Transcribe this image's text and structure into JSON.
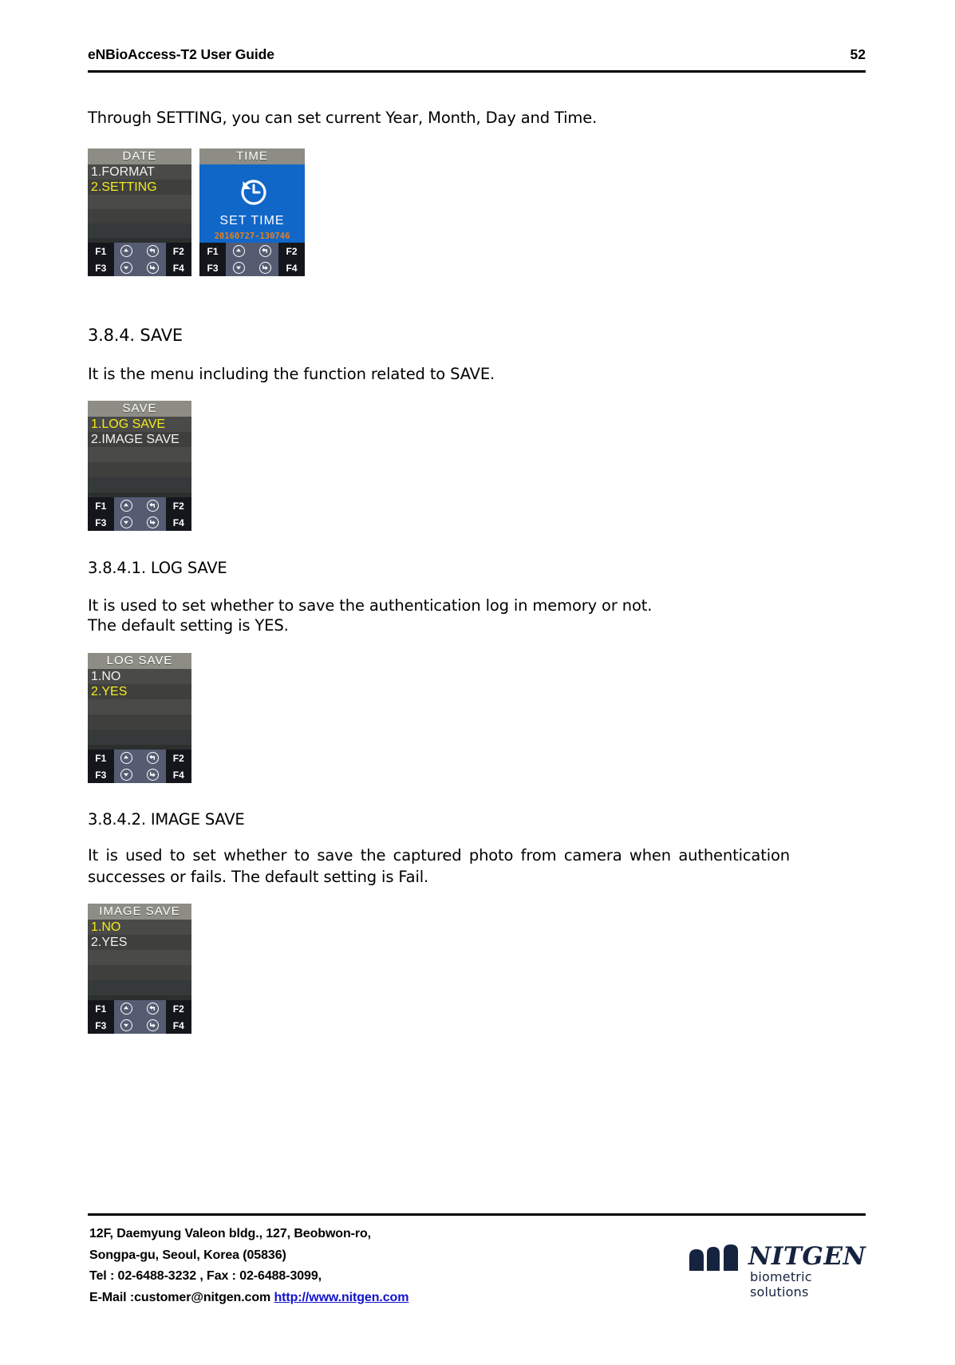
{
  "header": {
    "title": "eNBioAccess-T2 User Guide",
    "page_number": "52"
  },
  "body": {
    "intro_paragraph": "Through SETTING, you can set current Year, Month, Day and Time.",
    "section_save_heading": "3.8.4.  SAVE",
    "section_save_text": "It is the menu including the function related to SAVE.",
    "section_log_save_heading": "3.8.4.1. LOG SAVE",
    "section_log_save_text_line1": "It is used to set whether to save the authentication log in memory or not.",
    "section_log_save_text_line2": "The default setting is YES.",
    "section_image_save_heading": "3.8.4.2. IMAGE SAVE",
    "section_image_save_text": "It is used to set whether to save the captured photo from camera when authentication successes or fails. The default setting is Fail."
  },
  "keys": {
    "f1": "F1",
    "f2": "F2",
    "f3": "F3",
    "f4": "F4",
    "up_icon": "up-arrow-circle-icon",
    "back_icon": "back-arrow-circle-icon",
    "down_icon": "down-arrow-circle-icon",
    "forward_icon": "forward-arrow-circle-icon"
  },
  "screens": {
    "date": {
      "title": "DATE",
      "items": [
        {
          "label": "1.FORMAT",
          "selected": false
        },
        {
          "label": "2.SETTING",
          "selected": true
        }
      ]
    },
    "time": {
      "title": "TIME",
      "clock_icon": "set-time-clock-icon",
      "label": "SET TIME",
      "timestamp": "20160727-130746"
    },
    "save": {
      "title": "SAVE",
      "items": [
        {
          "label": "1.LOG SAVE",
          "selected": true
        },
        {
          "label": "2.IMAGE SAVE",
          "selected": false
        }
      ]
    },
    "log_save": {
      "title": "LOG SAVE",
      "items": [
        {
          "label": "1.NO",
          "selected": false
        },
        {
          "label": "2.YES",
          "selected": true
        }
      ]
    },
    "image_save": {
      "title": "IMAGE SAVE",
      "items": [
        {
          "label": "1.NO",
          "selected": true
        },
        {
          "label": "2.YES",
          "selected": false
        }
      ]
    }
  },
  "footer": {
    "address_line1": "12F, Daemyung Valeon bldg., 127, Beobwon-ro,",
    "address_line2": "Songpa-gu, Seoul, Korea (05836)",
    "address_line3": "Tel : 02-6488-3232 , Fax : 02-6488-3099,",
    "address_line4_prefix": "E-Mail :customer@nitgen.com ",
    "address_line4_link": "http://www.nitgen.com",
    "logo_name": "NITGEN",
    "logo_tagline": "biometric solutions"
  },
  "colors": {
    "lcd_bg": "#3a3a38",
    "lcd_title_bg": "#8d8d85",
    "lcd_selected_text": "#f2ec1f",
    "lcd_blue": "#1167c8",
    "timestamp_orange": "#e8801a",
    "link_blue": "#1111cc",
    "logo_navy": "#16233f"
  }
}
